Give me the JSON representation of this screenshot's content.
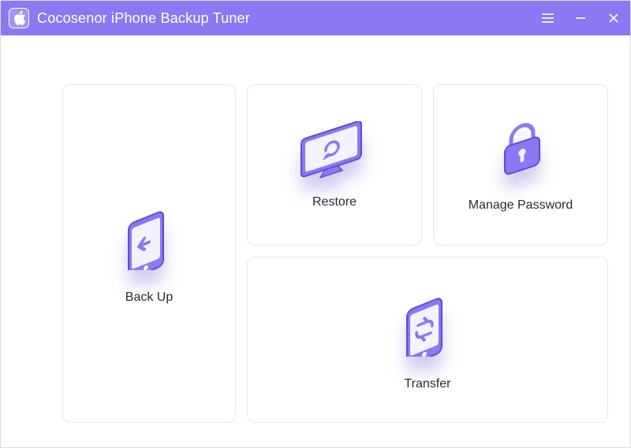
{
  "app": {
    "title": "Cocosenor iPhone Backup Tuner"
  },
  "controls": {
    "menu": "menu-icon",
    "minimize": "minimize-icon",
    "close": "close-icon"
  },
  "tiles": {
    "backup": {
      "label": "Back Up",
      "icon": "phone-back-icon",
      "interactable": true
    },
    "restore": {
      "label": "Restore",
      "icon": "monitor-restore-icon",
      "interactable": true
    },
    "password": {
      "label": "Manage Password",
      "icon": "lock-icon",
      "interactable": true
    },
    "transfer": {
      "label": "Transfer",
      "icon": "phone-sync-icon",
      "interactable": true
    }
  },
  "colors": {
    "accent": "#8b78f2",
    "accentDark": "#5d4cd6",
    "arrow": "#0db0e3"
  }
}
